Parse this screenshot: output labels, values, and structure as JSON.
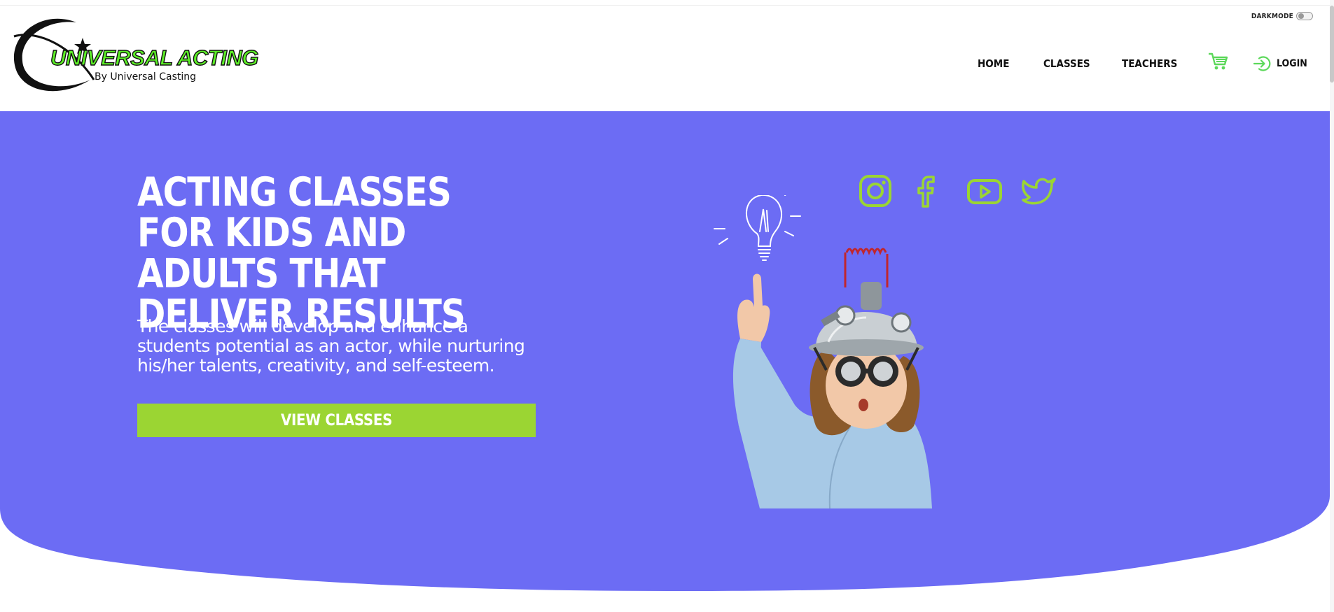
{
  "brand": {
    "name": "UNIVERSAL ACTING",
    "tagline": "By Universal Casting",
    "accent": "#5cf026"
  },
  "header": {
    "darkmode_label": "DARKMODE",
    "darkmode_on": false,
    "nav": [
      {
        "label": "HOME"
      },
      {
        "label": "CLASSES"
      },
      {
        "label": "TEACHERS"
      }
    ],
    "cart_icon": "shopping-cart-icon",
    "login_icon": "login-arrow-icon",
    "login_label": "LOGIN",
    "icon_color": "#5cd85a"
  },
  "hero": {
    "background_color": "#6c6cf4",
    "title": "ACTING CLASSES FOR KIDS AND ADULTS THAT DELIVER RESULTS",
    "description": "The classes will develop and enhance a students potential as an actor, while nurturing his/her talents, creativity, and self-esteem.",
    "cta_label": "VIEW CLASSES",
    "cta_color": "#9bd533",
    "social_icons": [
      "instagram-icon",
      "facebook-icon",
      "youtube-icon",
      "twitter-icon"
    ],
    "social_color": "#9bd533",
    "illustration": "child-with-foil-helmet-and-lightbulb"
  }
}
